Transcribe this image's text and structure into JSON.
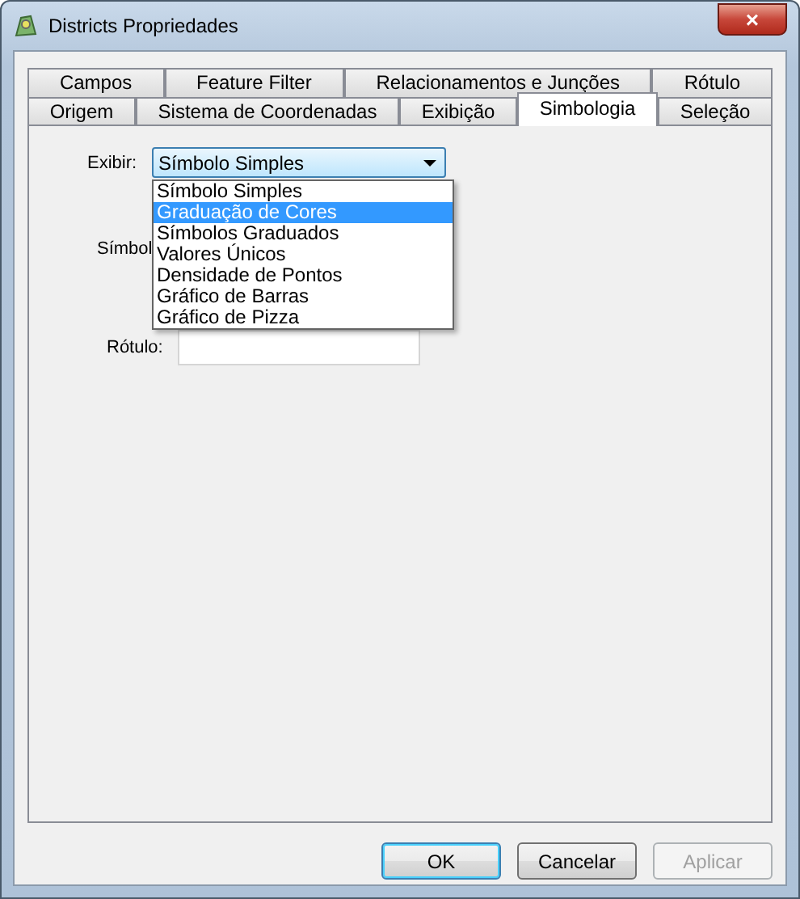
{
  "window": {
    "title": "Districts Propriedades",
    "close": "×"
  },
  "tab_rows": [
    [
      {
        "label": "Campos",
        "selected": false
      },
      {
        "label": "Feature Filter",
        "selected": false
      },
      {
        "label": "Relacionamentos e Junções",
        "selected": false
      },
      {
        "label": "Rótulo",
        "selected": false
      }
    ],
    [
      {
        "label": "Origem",
        "selected": false
      },
      {
        "label": "Sistema de Coordenadas",
        "selected": false
      },
      {
        "label": "Exibição",
        "selected": false
      },
      {
        "label": "Simbologia",
        "selected": true
      },
      {
        "label": "Seleção",
        "selected": false
      }
    ]
  ],
  "exibir": {
    "label": "Exibir:",
    "value": "Símbolo Simples",
    "expanded": true,
    "options": [
      {
        "label": "Símbolo Simples",
        "highlighted": false
      },
      {
        "label": "Graduação de Cores",
        "highlighted": true
      },
      {
        "label": "Símbolos Graduados",
        "highlighted": false
      },
      {
        "label": "Valores Únicos",
        "highlighted": false
      },
      {
        "label": "Densidade de Pontos",
        "highlighted": false
      },
      {
        "label": "Gráfico de Barras",
        "highlighted": false
      },
      {
        "label": "Gráfico de Pizza",
        "highlighted": false
      }
    ]
  },
  "simbolo_label": "Símbol",
  "rotulo": {
    "label": "Rótulo:"
  },
  "buttons": [
    {
      "label": "OK",
      "disabled": false,
      "default": true
    },
    {
      "label": "Cancelar",
      "disabled": false,
      "default": false
    },
    {
      "label": "Aplicar",
      "disabled": true,
      "default": false
    }
  ]
}
